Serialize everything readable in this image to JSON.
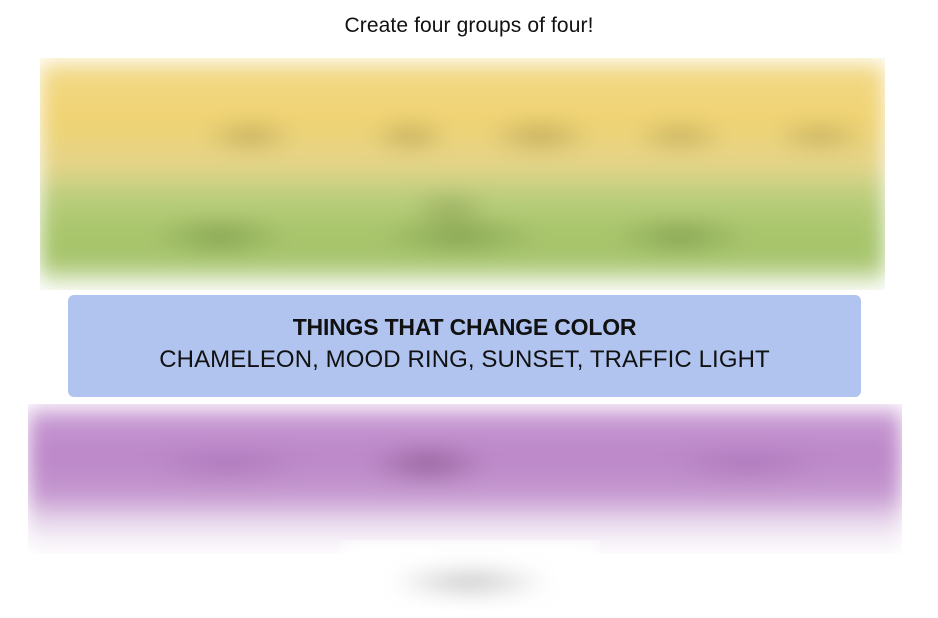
{
  "instructions": "Create four groups of four!",
  "groups": {
    "solved": {
      "title": "THINGS THAT CHANGE COLOR",
      "members": "CHAMELEON, MOOD RING, SUNSET, TRAFFIC LIGHT",
      "color": "#b0c4ef"
    },
    "obscured": [
      {
        "color": "#f0d372"
      },
      {
        "color": "#a6c46c"
      },
      {
        "color": "#bc86c8"
      }
    ]
  }
}
